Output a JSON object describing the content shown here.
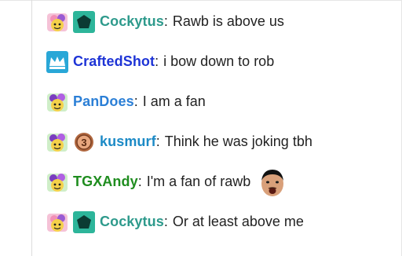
{
  "colors": {
    "cockytus": "#2e9a8c",
    "craftedshot": "#1e34d6",
    "pandoes": "#2b7fd6",
    "kusmurf": "#1c8ac6",
    "tgxandy": "#1f8d1f",
    "text": "#222222",
    "pentagon_bg": "#2db59a",
    "crown_bg": "#29a7d7",
    "coin": "#b0673f"
  },
  "messages": [
    {
      "badges": [
        {
          "icon": "sub-badge-cupid-icon"
        },
        {
          "icon": "pentagon-badge-icon"
        }
      ],
      "user": "Cockytus",
      "text": "Rawb is above us"
    },
    {
      "badges": [
        {
          "icon": "crown-badge-icon"
        }
      ],
      "user": "CraftedShot",
      "text": "i bow down to rob"
    },
    {
      "badges": [
        {
          "icon": "sub-badge-flower-icon"
        }
      ],
      "user": "PanDoes",
      "text": "I am a fan"
    },
    {
      "badges": [
        {
          "icon": "sub-badge-flower-icon"
        },
        {
          "icon": "coin-badge-icon",
          "label": "3"
        }
      ],
      "user": "kusmurf",
      "text": "Think he was joking tbh"
    },
    {
      "badges": [
        {
          "icon": "sub-badge-flower-icon"
        }
      ],
      "user": "TGXAndy",
      "text": "I'm a fan of rawb",
      "emote": "face-emote-icon"
    },
    {
      "badges": [
        {
          "icon": "sub-badge-cupid-icon"
        },
        {
          "icon": "pentagon-badge-icon"
        }
      ],
      "user": "Cockytus",
      "text": "Or at least above me"
    }
  ]
}
